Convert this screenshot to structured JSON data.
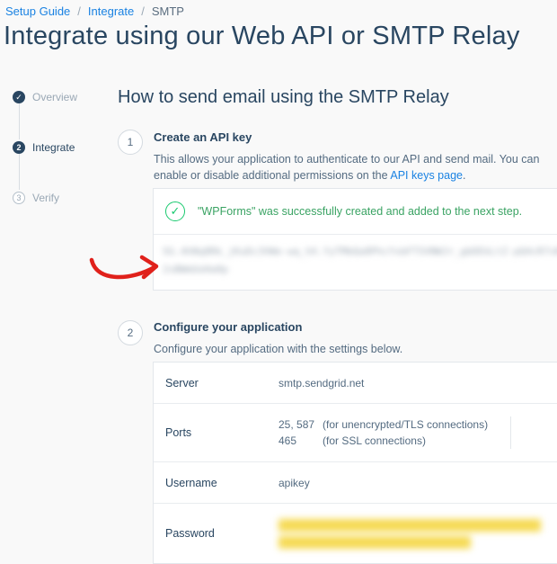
{
  "breadcrumb": {
    "item1": "Setup Guide",
    "item2": "Integrate",
    "item3": "SMTP"
  },
  "page": {
    "title": "Integrate using our Web API or SMTP Relay"
  },
  "steps": [
    {
      "num": "✓",
      "label": "Overview"
    },
    {
      "num": "2",
      "label": "Integrate"
    },
    {
      "num": "3",
      "label": "Verify"
    }
  ],
  "section": {
    "title": "How to send email using the SMTP Relay"
  },
  "step1": {
    "num": "1",
    "title": "Create an API key",
    "desc_pre": "This allows your application to authenticate to our API and send mail. You can enable or disable additional permissions on the ",
    "link": "API keys page",
    "desc_post": ".",
    "success": "\"WPForms\" was successfully created and added to the next step.",
    "key_value": "SG.4hNq8Rk_jKuDc3VWe-wq_hX.YyTMbQa8PhcYxbFTSVNWJr_gbDEkLtZ-pQ4cR7vN2sBWmUoHa0p"
  },
  "step2": {
    "num": "2",
    "title": "Configure your application",
    "desc": "Configure your application with the settings below.",
    "server_label": "Server",
    "server_value": "smtp.sendgrid.net",
    "ports_label": "Ports",
    "port1": "25, 587",
    "port1_note": "(for unencrypted/TLS connections)",
    "port2": "465",
    "port2_note": "(for SSL connections)",
    "username_label": "Username",
    "username_value": "apikey",
    "password_label": "Password"
  },
  "colors": {
    "accent": "#1a82e2",
    "success": "#18c96e",
    "annotation": "#e0211b"
  }
}
